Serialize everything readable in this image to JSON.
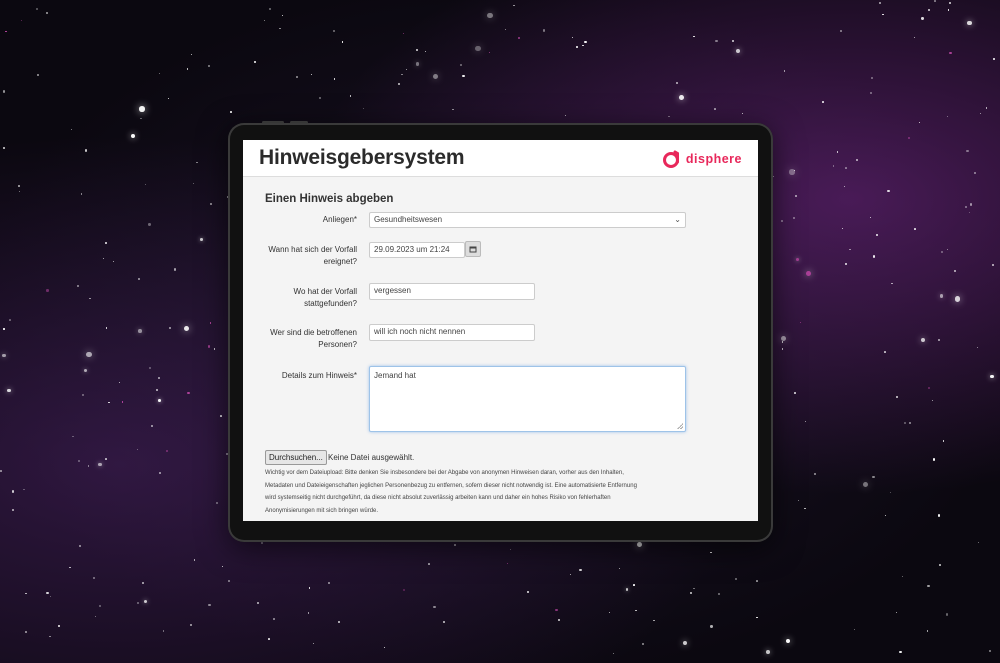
{
  "app": {
    "title": "Hinweisgebersystem",
    "brand": "disphere",
    "brand_color": "#e8285b"
  },
  "form": {
    "section_title": "Einen Hinweis abgeben",
    "anliegen": {
      "label": "Anliegen*",
      "value": "Gesundheitswesen"
    },
    "wann": {
      "label_line1": "Wann hat sich der Vorfall",
      "label_line2": "ereignet?",
      "value": "29.09.2023 um 21:24",
      "button_icon": "calendar-icon"
    },
    "wo": {
      "label_line1": "Wo hat der Vorfall",
      "label_line2": "stattgefunden?",
      "value": "vergessen"
    },
    "wer": {
      "label_line1": "Wer sind die betroffenen",
      "label_line2": "Personen?",
      "value": "will ich noch nicht nennen"
    },
    "details": {
      "label": "Details zum Hinweis*",
      "value": "Jemand hat"
    },
    "upload": {
      "button_label": "Durchsuchen...",
      "status": "Keine Datei ausgewählt.",
      "notice_line1": "Wichtig vor dem Dateiupload: Bitte denken Sie insbesondere bei der Abgabe von anonymen Hinweisen daran, vorher aus den Inhalten,",
      "notice_line2": "Metadaten und Dateieigenschaften jeglichen Personenbezug zu entfernen, sofern dieser nicht notwendig ist. Eine automatisierte Entfernung",
      "notice_line3": "wird systemseitig nicht durchgeführt, da diese nicht absolut zuverlässig arbeiten kann und daher ein hohes Risiko von fehlerhaften",
      "notice_line4": "Anonymisierungen mit sich bringen würde."
    }
  }
}
